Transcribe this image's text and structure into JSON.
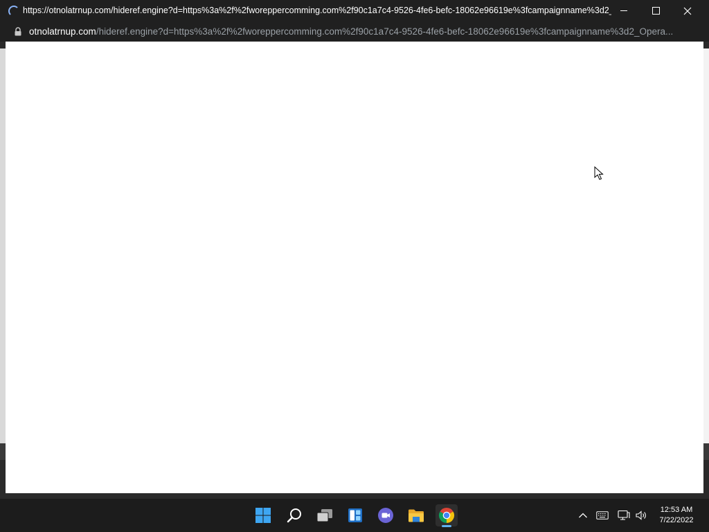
{
  "window": {
    "title": "https://otnolatrnup.com/hideref.engine?d=https%3a%2f%2fworeppercomming.com%2f90c1a7c4-9526-4fe6-befc-18062e96619e%3fcampaignname%3d2_Op...",
    "url_host": "otnolatrnup.com",
    "url_path": "/hideref.engine?d=https%3a%2f%2fworeppercomming.com%2f90c1a7c4-9526-4fe6-befc-18062e96619e%3fcampaignname%3d2_Opera..."
  },
  "taskbar": {
    "apps": [
      {
        "name": "start-icon"
      },
      {
        "name": "search-icon"
      },
      {
        "name": "task-view-icon"
      },
      {
        "name": "widgets-icon"
      },
      {
        "name": "teams-chat-icon"
      },
      {
        "name": "file-explorer-icon"
      },
      {
        "name": "chrome-icon",
        "active": true
      }
    ],
    "tray": [
      "chevron-up-icon",
      "keyboard-icon",
      "network-icon",
      "volume-icon"
    ],
    "time": "12:53 AM",
    "date": "7/22/2022"
  },
  "colors": {
    "titlebar": "#202020",
    "taskbar": "#1c1c1c",
    "accent": "#5fb2f2",
    "url_path": "#9aa0a6"
  }
}
